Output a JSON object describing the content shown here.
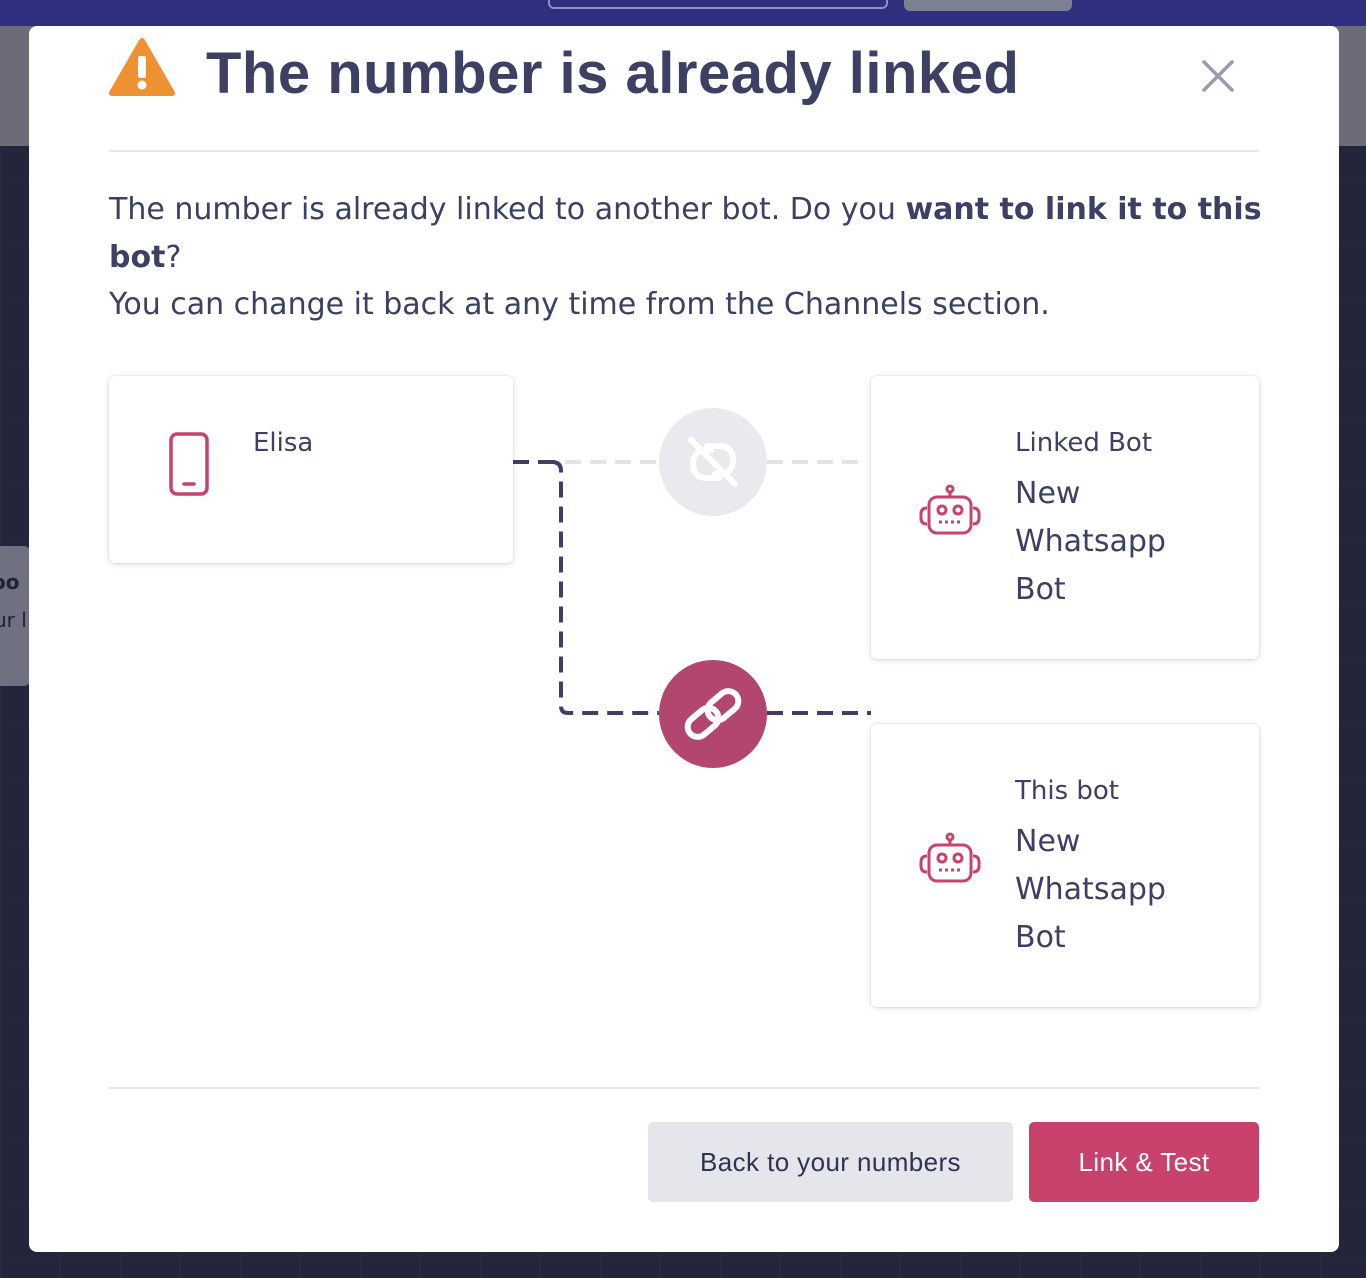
{
  "modal": {
    "title": "The number is already linked",
    "description": {
      "part1": "The number is already linked to another bot. Do you ",
      "bold1": "want to link it to this",
      "bold2": "bot",
      "part2": "?",
      "line2": "You can change it back at any time from the Channels section."
    }
  },
  "number_card": {
    "name": "Elisa",
    "phone": "",
    "icon": "phone-icon"
  },
  "linked_bot_card": {
    "label": "Linked Bot",
    "name": "New Whatsapp Bot",
    "icon": "robot-icon"
  },
  "this_bot_card": {
    "label": "This bot",
    "name": "New Whatsapp Bot",
    "icon": "robot-icon"
  },
  "connectors": {
    "unlinked_icon": "broken-link-icon",
    "linked_icon": "link-icon"
  },
  "buttons": {
    "back_label": "Back to your numbers",
    "link_label": "Link & Test"
  },
  "colors": {
    "accent": "#c9426c",
    "link_circle": "#b3466f",
    "text": "#3d3f63",
    "warning": "#ee9133",
    "unlink_circle": "#e8eaee"
  }
}
